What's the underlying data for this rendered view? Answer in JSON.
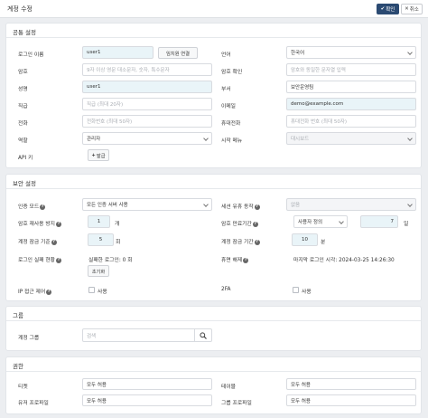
{
  "header": {
    "title": "계정 수정",
    "confirm_label": "확인",
    "cancel_label": "취소"
  },
  "general": {
    "title": "공통 설정",
    "login_id_label": "로그인 이름",
    "login_id_value": "user1",
    "dup_check_label": "임치원 연결",
    "language_label": "언어",
    "language_value": "한국어",
    "password_label": "암호",
    "password_placeholder": "9자 이상 영문 대소문자, 숫자, 특수문자",
    "password_confirm_label": "암호 확인",
    "password_confirm_placeholder": "암호와 동일한 문자열 입력",
    "name_label": "성명",
    "name_value": "user1",
    "dept_label": "부서",
    "dept_value": "보안운영팀",
    "position_label": "직급",
    "position_placeholder": "직급 (최대 20자)",
    "email_label": "이메일",
    "email_value": "demo@example.com",
    "phone_label": "전화",
    "phone_placeholder": "전화번호 (최대 50자)",
    "mobile_label": "휴대전화",
    "mobile_placeholder": "휴대전화 번호 (최대 50자)",
    "role_label": "역할",
    "role_value": "관리자",
    "start_menu_label": "시작 메뉴",
    "start_menu_value": "대시보드",
    "api_key_label": "API 키",
    "api_key_button": "발급"
  },
  "security": {
    "title": "보안 설정",
    "auth_mode_label": "인증 모드",
    "auth_mode_value": "모든 인증 서버 사용",
    "session_action_label": "세션 유휴 동작",
    "session_action_value": "없음",
    "pw_reuse_label": "암호 재사용 방지",
    "pw_reuse_value": "1",
    "pw_reuse_unit": "개",
    "pw_expire_label": "암호 만료기간",
    "pw_expire_select": "사용자 정의",
    "pw_expire_value": "7",
    "pw_expire_unit": "일",
    "lock_threshold_label": "계정 잠금 기준",
    "lock_threshold_value": "5",
    "lock_threshold_unit": "회",
    "lock_period_label": "계정 잠금 기간",
    "lock_period_value": "10",
    "lock_period_unit": "분",
    "fail_status_label": "로그인 실패 현황",
    "fail_status_value": "실패한 로그인: 0 회",
    "reset_button": "초기화",
    "dormant_label": "휴면 해제",
    "last_login_text": "마지막 로그인 시각: 2024-03-25 14:26:30",
    "ip_limit_label": "IP 접근 제어",
    "ip_limit_check": "사용",
    "twofa_label": "2FA",
    "twofa_check": "사용"
  },
  "group": {
    "title": "그룹",
    "account_group_label": "계정 그룹",
    "search_placeholder": "검색"
  },
  "permission": {
    "title": "권한",
    "ticket_label": "티켓",
    "ticket_value": "모두 허용",
    "table_label": "테이블",
    "table_value": "모두 허용",
    "user_profile_label": "유저 프로파일",
    "user_profile_value": "모두 허용",
    "group_profile_label": "그룹 프로파일",
    "group_profile_value": "모두 허용"
  }
}
